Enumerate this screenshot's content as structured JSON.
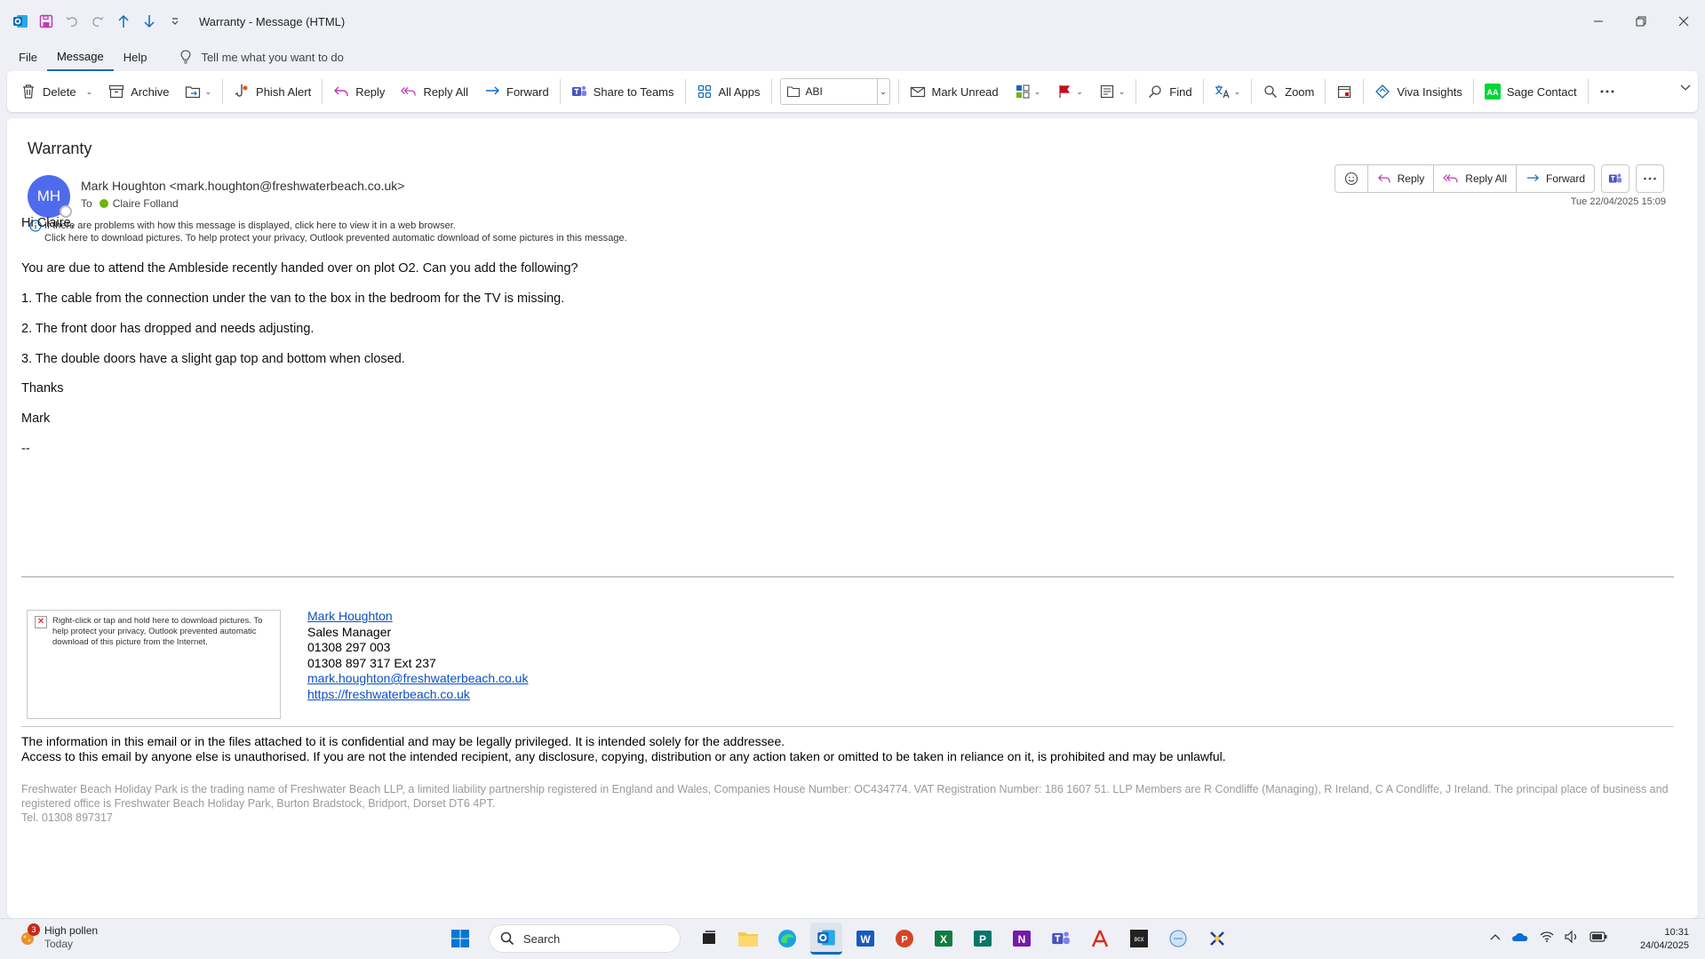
{
  "window": {
    "title": "Warranty",
    "title_sep": " - ",
    "title_suffix": "Message (HTML)"
  },
  "menu": {
    "tabs": [
      "File",
      "Message",
      "Help"
    ],
    "active_tab": "Message",
    "tell_me": "Tell me what you want to do"
  },
  "ribbon": {
    "delete": "Delete",
    "archive": "Archive",
    "phish_alert": "Phish Alert",
    "reply": "Reply",
    "reply_all": "Reply All",
    "forward": "Forward",
    "share_teams": "Share to Teams",
    "all_apps": "All Apps",
    "folder_combo": "ABI",
    "mark_unread": "Mark Unread",
    "find": "Find",
    "zoom": "Zoom",
    "viva_insights": "Viva Insights",
    "sage_contact": "Sage Contact"
  },
  "message": {
    "subject": "Warranty",
    "avatar_initials": "MH",
    "sender": "Mark Houghton <mark.houghton@freshwaterbeach.co.uk>",
    "to_label": "To",
    "recipient": "Claire Folland",
    "info_line1": "If there are problems with how this message is displayed, click here to view it in a web browser.",
    "info_line2": "Click here to download pictures. To help protect your privacy, Outlook prevented automatic download of some pictures in this message.",
    "date": "Tue 22/04/2025 15:09",
    "actions": {
      "reply": "Reply",
      "reply_all": "Reply All",
      "forward": "Forward"
    }
  },
  "body": {
    "greeting": "Hi Claire,",
    "intro": "You are due to attend the Ambleside recently handed over on plot O2. Can you add the following?",
    "item1": "1. The cable from the connection under the van to the box in the bedroom for the TV is missing.",
    "item2": "2. The front door has dropped and needs adjusting.",
    "item3": "3. The double doors have a slight gap top and bottom when closed.",
    "thanks": "Thanks",
    "name": "Mark",
    "dashes": "--"
  },
  "signature": {
    "image_placeholder": "Right-click or tap and hold here to download pictures. To help protect your privacy, Outlook prevented automatic download of this picture from the Internet.",
    "name": "Mark Houghton",
    "role": "Sales Manager",
    "phone1": "01308 297 003",
    "phone2": "01308 897 317 Ext 237",
    "email": "mark.houghton@freshwaterbeach.co.uk",
    "website": "https://freshwaterbeach.co.uk"
  },
  "confidential": {
    "line1": "The information in this email or in the files attached to it is confidential and may be legally privileged. It is intended solely for the addressee.",
    "line2": "Access to this email by anyone else is unauthorised. If you are not the intended recipient, any disclosure, copying, distribution or any action taken or omitted to be taken in reliance on it, is prohibited and may be unlawful."
  },
  "legal": {
    "text": "Freshwater Beach Holiday Park is the trading name of Freshwater Beach LLP, a limited liability partnership registered in England and Wales, Companies House Number: OC434774. VAT Registration Number: 186 1607 51. LLP Members are R Condliffe (Managing), R Ireland, C A Condliffe, J Ireland. The principal place of business and registered office is Freshwater Beach Holiday Park, Burton Bradstock, Bridport, Dorset DT6 4PT.",
    "tel": "Tel. 01308 897317"
  },
  "taskbar": {
    "weather_badge": "3",
    "weather_title": "High pollen",
    "weather_sub": "Today",
    "search": "Search",
    "time": "10:31",
    "date": "24/04/2025"
  },
  "colors": {
    "accent": "#0f6cbd",
    "avatar": "#4f6bed",
    "link": "#0b50c4",
    "presence": "#6bb700"
  }
}
